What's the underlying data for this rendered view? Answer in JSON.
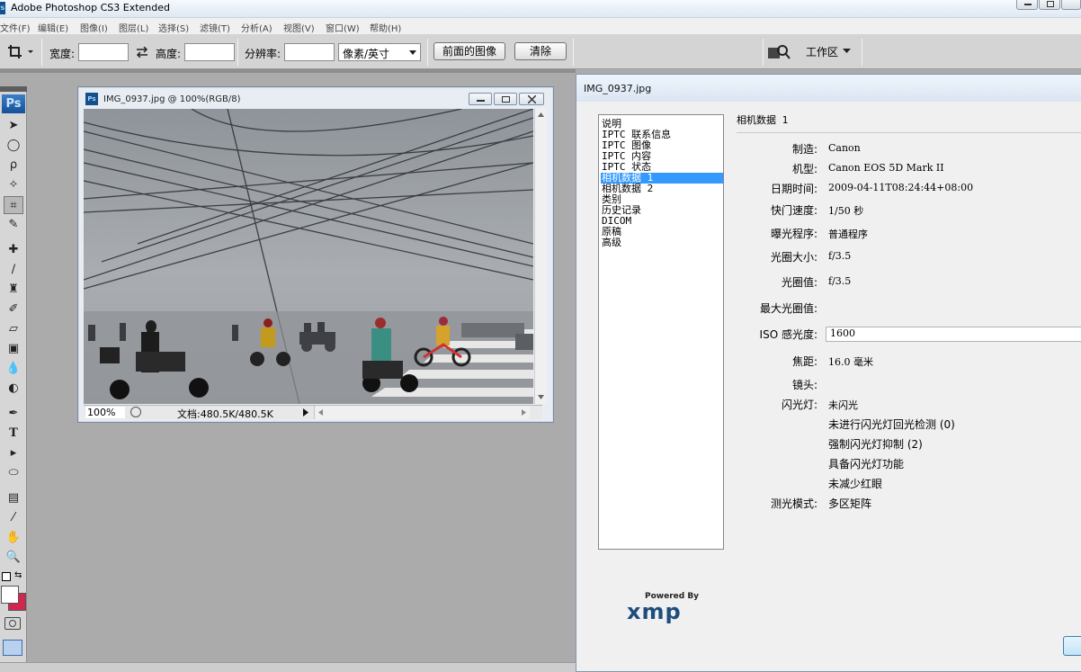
{
  "app": {
    "title": "Adobe Photoshop CS3 Extended",
    "icon": "Ps"
  },
  "menu": [
    "文件(F)",
    "编辑(E)",
    "图像(I)",
    "图层(L)",
    "选择(S)",
    "滤镜(T)",
    "分析(A)",
    "视图(V)",
    "窗口(W)",
    "帮助(H)"
  ],
  "options": {
    "width_label": "宽度:",
    "height_label": "高度:",
    "resolution_label": "分辨率:",
    "unit_value": "像素/英寸",
    "front_image_btn": "前面的图像",
    "clear_btn": "清除",
    "workspace_label": "工作区"
  },
  "toolbox": {
    "logo": "Ps"
  },
  "document": {
    "title": "IMG_0937.jpg @ 100%(RGB/8)",
    "zoom": "100%",
    "doc_size": "文档:480.5K/480.5K"
  },
  "file_info": {
    "title": "IMG_0937.jpg",
    "categories": [
      "说明",
      "IPTC 联系信息",
      "IPTC 图像",
      "IPTC 内容",
      "IPTC 状态",
      "相机数据 1",
      "相机数据 2",
      "类别",
      "历史记录",
      "DICOM",
      "原稿",
      "高级"
    ],
    "selected_category": "相机数据 1",
    "section_title": "相机数据 1",
    "fields": [
      {
        "label": "制造:",
        "value": "Canon"
      },
      {
        "label": "机型:",
        "value": "Canon EOS 5D Mark II"
      },
      {
        "label": "日期时间:",
        "value": "2009-04-11T08:24:44+08:00"
      },
      {
        "label": "快门速度:",
        "value": "1/50 秒"
      },
      {
        "label": "曝光程序:",
        "value": "普通程序"
      },
      {
        "label": "光圈大小:",
        "value": "f/3.5"
      },
      {
        "label": "光圈值:",
        "value": "f/3.5"
      },
      {
        "label": "最大光圈值:",
        "value": ""
      },
      {
        "label": "ISO 感光度:",
        "value": "1600"
      },
      {
        "label": "焦距:",
        "value": "16.0 毫米"
      },
      {
        "label": "镜头:",
        "value": ""
      },
      {
        "label": "闪光灯:",
        "value": "未闪光"
      }
    ],
    "flash_details": [
      "未进行闪光灯回光检测 (0)",
      "强制闪光灯抑制 (2)",
      "具备闪光灯功能",
      "未减少红眼"
    ],
    "metering_label": "测光模式:",
    "metering_value": "多区矩阵",
    "xmp_powered": "Powered By",
    "xmp_logo": "xmp"
  }
}
